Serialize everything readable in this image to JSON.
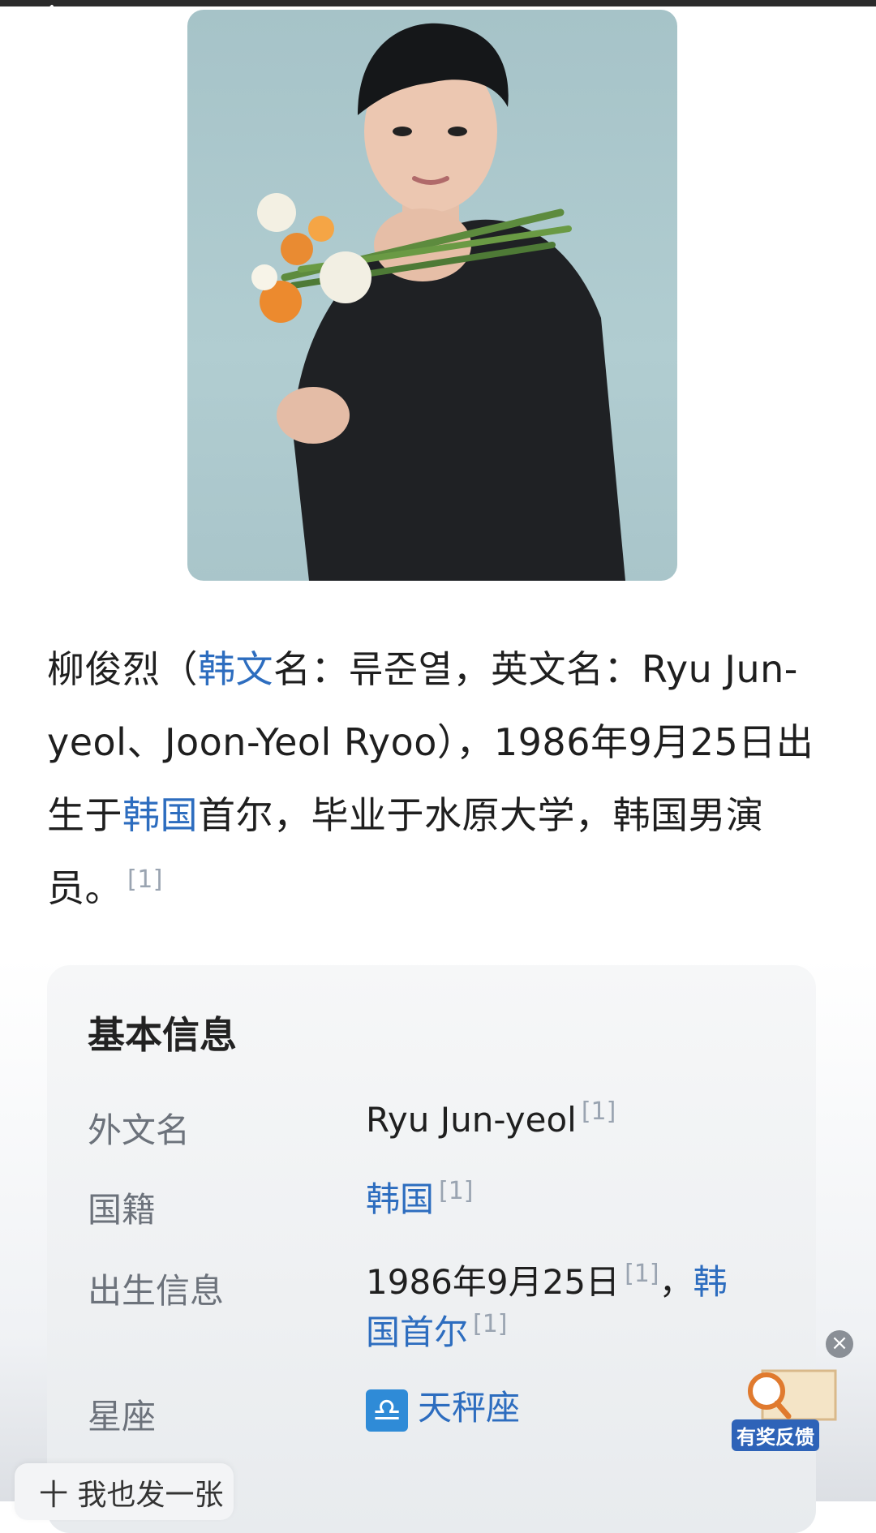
{
  "intro": {
    "p1": "柳俊烈（",
    "link1": "韩文",
    "p2": "名：류준열，英文名：Ryu Jun-yeol、Joon-Yeol Ryoo），1986年9月25日出生于",
    "link2": "韩国",
    "p3": "首尔，毕业于水原大学，韩国男演员。",
    "ref": "[1]"
  },
  "card": {
    "title": "基本信息",
    "rows": [
      {
        "label": "外文名",
        "value": "Ryu Jun-yeol",
        "ref": "[1]"
      },
      {
        "label": "国籍",
        "value": "韩国",
        "ref": "[1]"
      },
      {
        "label": "出生信息",
        "value1": "1986年9月25日",
        "ref1": "[1]",
        "sep": "，",
        "value2": "韩国首尔",
        "ref2": "[1]"
      },
      {
        "label": "星座",
        "value": "天秤座",
        "icon": "libra-icon"
      }
    ]
  },
  "feedback": {
    "label": "有奖反馈",
    "close": "×"
  },
  "bottom": {
    "label": "十 我也发一张"
  },
  "colors": {
    "link": "#2d6dbf",
    "label": "#6c727b"
  }
}
